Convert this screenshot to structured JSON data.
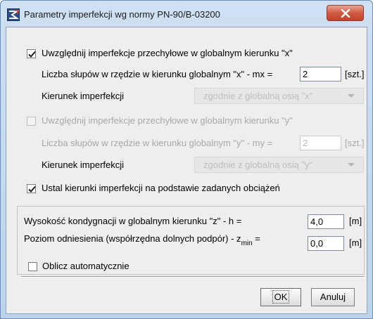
{
  "window": {
    "title": "Parametry imperfekcji wg normy PN-90/B-03200"
  },
  "x_section": {
    "checkbox_label": "Uwzględnij imperfekcje przechyłowe w globalnym kierunku \"x\"",
    "checked": true,
    "columns_label": "Liczba słupów w rzędzie w kierunku globalnym \"x\" - mx =",
    "columns_value": "2",
    "columns_unit": "[szt.]",
    "direction_label": "Kierunek imperfekcji",
    "direction_value": "zgodnie z globalną osią \"x\""
  },
  "y_section": {
    "checkbox_label": "Uwzględnij imperfekcje przechyłowe w globalnym kierunku \"y\"",
    "checked": false,
    "columns_label": "Liczba słupów w rzędzie w kierunku globalnym \"y\" - my =",
    "columns_value": "2",
    "columns_unit": "[szt.]",
    "direction_label": "Kierunek imperfekcji",
    "direction_value": "zgodnie z globalną osią \"y\""
  },
  "load_direction": {
    "checkbox_label": "Ustal kierunki imperfekcji na podstawie zadanych obciążeń",
    "checked": true
  },
  "height_panel": {
    "height_label": "Wysokość kondygnacji w globalnym kierunku \"z\" - h =",
    "height_value": "4,0",
    "height_unit": "[m]",
    "level_label_prefix": "Poziom odniesienia (współrzędna dolnych podpór) - z",
    "level_label_sub": "min",
    "level_label_suffix": " =",
    "level_value": "0,0",
    "level_unit": "[m]",
    "auto_label": "Oblicz automatycznie",
    "auto_checked": false
  },
  "buttons": {
    "ok": "OK",
    "cancel": "Anuluj"
  },
  "colors": {
    "title_bar": "#c4d8ef",
    "dialog_bg": "#eeeeee",
    "close_button": "#c9503a"
  },
  "icons": {
    "app": "app-icon",
    "close": "close-icon",
    "check": "check-icon",
    "dropdown": "chevron-down-icon"
  }
}
